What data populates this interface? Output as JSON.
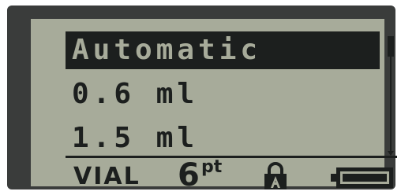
{
  "menu": {
    "items": [
      {
        "label": "Automatic",
        "selected": true
      },
      {
        "label": "0.6 ml",
        "selected": false
      },
      {
        "label": "1.5 ml",
        "selected": false
      }
    ]
  },
  "status": {
    "media_type": "VIAL",
    "font_size": "6",
    "font_size_unit": "pt",
    "caps_lock_icon": "caps-lock-icon",
    "battery_icon": "battery-icon"
  },
  "colors": {
    "lcd_background": "#a7ab9a",
    "lcd_ink": "#1c1f1e",
    "bezel": "#3a3c3b"
  }
}
